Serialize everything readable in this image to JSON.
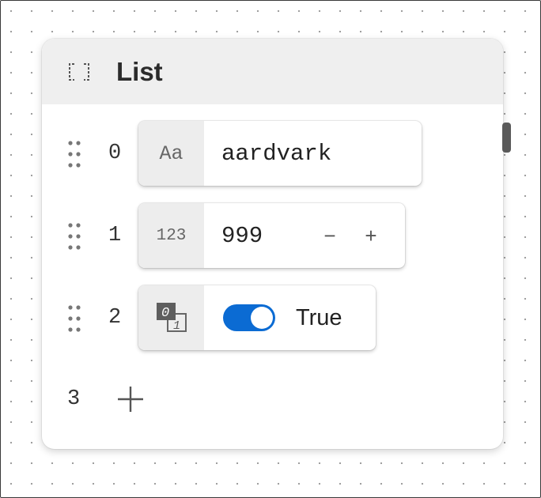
{
  "card": {
    "title": "List",
    "icon": "list-bracket-icon"
  },
  "items": [
    {
      "index": "0",
      "type": "string",
      "type_label": "Aa",
      "value": "aardvark"
    },
    {
      "index": "1",
      "type": "number",
      "type_label": "123",
      "value": "999",
      "decrement": "−",
      "increment": "+"
    },
    {
      "index": "2",
      "type": "boolean",
      "type_icon": "boolean-type-icon",
      "value": "True",
      "checked": true
    }
  ],
  "next_index": "3",
  "add_icon": "plus-icon",
  "colors": {
    "toggle_on": "#0b6bd3",
    "header_bg": "#efefef"
  }
}
